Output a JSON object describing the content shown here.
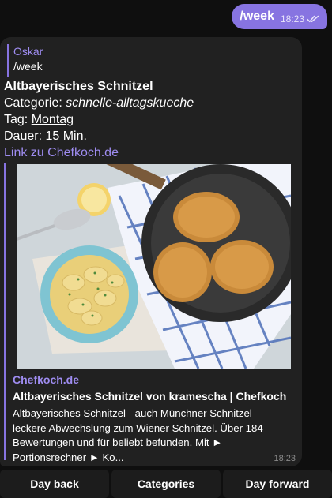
{
  "outgoing": {
    "command": "/week",
    "time": "18:23"
  },
  "incoming": {
    "reply": {
      "author": "Oskar",
      "text": "/week"
    },
    "title": "Altbayerisches Schnitzel",
    "category_label": "Categorie: ",
    "category_value": "schnelle-alltagskueche",
    "tag_label": "Tag: ",
    "tag_value": "Montag",
    "duration": "Dauer: 15 Min.",
    "link_text": "Link zu Chefkoch.de",
    "preview": {
      "site": "Chefkoch.de",
      "title": "Altbayerisches Schnitzel von kramescha | Chefkoch",
      "description": "Altbayerisches Schnitzel - auch Münchner Schnitzel - leckere Abwechslung zum Wiener Schnitzel. Über 184 Bewertungen und für beliebt befunden. Mit ► Portionsrechner ► Ko..."
    },
    "time": "18:23"
  },
  "keyboard": {
    "buttons": [
      "Day back",
      "Categories",
      "Day forward"
    ]
  },
  "colors": {
    "accent": "#8774e1",
    "bubble_in": "#212121",
    "background": "#0f0f0f"
  }
}
